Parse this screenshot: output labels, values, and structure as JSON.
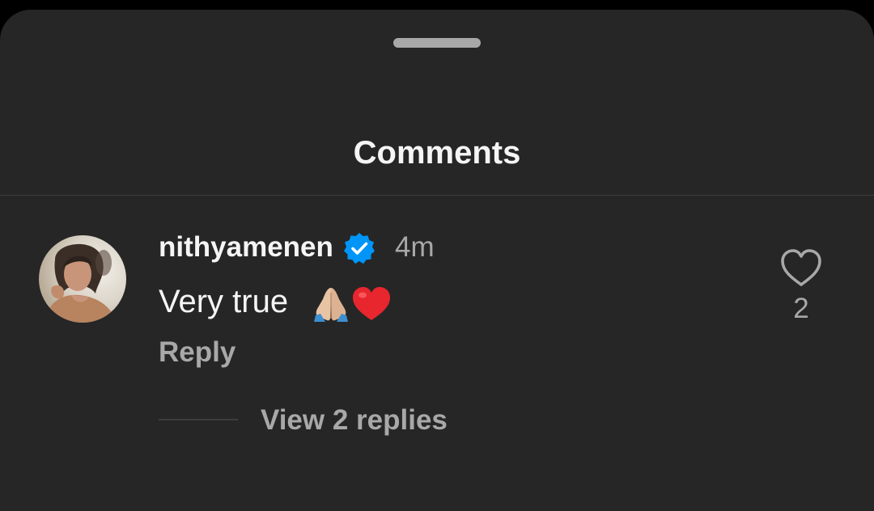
{
  "sheet": {
    "title": "Comments"
  },
  "comment": {
    "username": "nithyamenen",
    "verified_icon": "verified-badge-icon",
    "time": "4m",
    "text": "Very true",
    "emojis": [
      "folded-hands-emoji",
      "red-heart-emoji"
    ],
    "reply_label": "Reply",
    "like_icon": "heart-outline-icon",
    "like_count": "2",
    "view_replies_label": "View 2 replies"
  },
  "colors": {
    "background": "#262626",
    "primary_text": "#f5f5f5",
    "secondary_text": "#a8a8a8",
    "verified_blue": "#0095f6",
    "heart_red": "#e8262e"
  }
}
